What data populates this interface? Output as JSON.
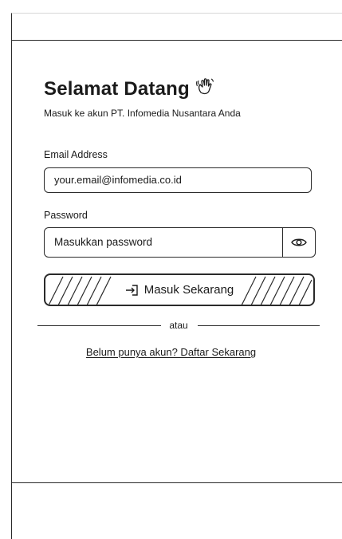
{
  "login": {
    "title": "Selamat Datang",
    "subtitle": "Masuk ke akun PT. Infomedia Nusantara Anda",
    "email_label": "Email Address",
    "email_value": "your.email@infomedia.co.id",
    "password_label": "Password",
    "password_placeholder": "Masukkan password",
    "submit_label": "Masuk Sekarang",
    "divider_text": "atau",
    "register_link": "Belum punya akun? Daftar Sekarang"
  },
  "icons": {
    "title_icon": "waving-hand-icon",
    "password_toggle_icon": "eye-icon",
    "submit_icon": "enter-icon"
  }
}
